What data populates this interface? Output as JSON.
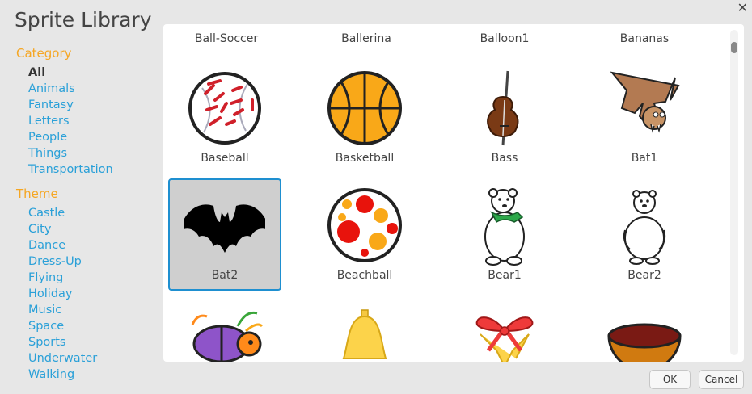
{
  "dialog": {
    "title": "Sprite Library"
  },
  "sidebar": {
    "category_heading": "Category",
    "categories": [
      "All",
      "Animals",
      "Fantasy",
      "Letters",
      "People",
      "Things",
      "Transportation"
    ],
    "theme_heading": "Theme",
    "themes": [
      "Castle",
      "City",
      "Dance",
      "Dress-Up",
      "Flying",
      "Holiday",
      "Music",
      "Space",
      "Sports",
      "Underwater",
      "Walking"
    ]
  },
  "library": {
    "top_row_labels": [
      "Ball-Soccer",
      "Ballerina",
      "Balloon1",
      "Bananas"
    ],
    "sprites": [
      {
        "name": "Baseball",
        "icon": "baseball-icon"
      },
      {
        "name": "Basketball",
        "icon": "basketball-icon"
      },
      {
        "name": "Bass",
        "icon": "bass-icon"
      },
      {
        "name": "Bat1",
        "icon": "bat1-icon"
      },
      {
        "name": "Bat2",
        "icon": "bat2-icon",
        "selected": true
      },
      {
        "name": "Beachball",
        "icon": "beachball-icon"
      },
      {
        "name": "Bear1",
        "icon": "bear1-icon"
      },
      {
        "name": "Bear2",
        "icon": "bear2-icon"
      },
      {
        "name": "",
        "icon": "beetle-icon"
      },
      {
        "name": "",
        "icon": "bell-icon"
      },
      {
        "name": "",
        "icon": "bells-icon"
      },
      {
        "name": "",
        "icon": "bowl-icon"
      }
    ]
  },
  "buttons": {
    "ok": "OK",
    "cancel": "Cancel"
  },
  "close_glyph": "✕"
}
